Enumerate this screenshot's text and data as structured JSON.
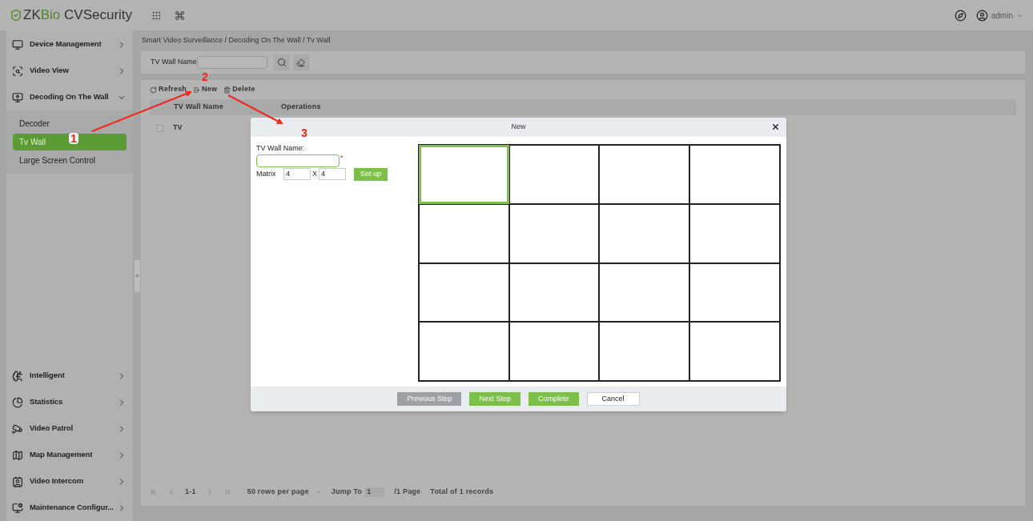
{
  "header": {
    "logo_part_1": "ZK",
    "logo_part_2": "Bio",
    "logo_part_3": "CVSecurity",
    "user": "admin"
  },
  "sidebar": {
    "top_items": [
      {
        "label": "Device Management",
        "expanded": false
      },
      {
        "label": "Video View",
        "expanded": false
      },
      {
        "label": "Decoding On The Wall",
        "expanded": true,
        "children": [
          {
            "label": "Decoder",
            "selected": false
          },
          {
            "label": "Tv Wall",
            "selected": true
          },
          {
            "label": "Large Screen Control",
            "selected": false
          }
        ]
      }
    ],
    "bottom_items": [
      {
        "label": "Intelligent",
        "expanded": false
      },
      {
        "label": "Statistics",
        "expanded": false
      },
      {
        "label": "Video Patrol",
        "expanded": false
      },
      {
        "label": "Map Management",
        "expanded": false
      },
      {
        "label": "Video Intercom",
        "expanded": false
      },
      {
        "label": "Maintenance Configur...",
        "expanded": false
      }
    ]
  },
  "breadcrumb": "Smart Video Surveillance / Decoding On The Wall / Tv Wall",
  "search": {
    "label": "TV Wall Name"
  },
  "toolbar": [
    "Refresh",
    "New",
    "Delete"
  ],
  "table": {
    "columns": [
      "TV Wall Name",
      "Operations"
    ],
    "rows": [
      {
        "name": "TV",
        "checked": false
      }
    ]
  },
  "pagination": {
    "range": "1-1",
    "page_size": "50 rows per page",
    "jump_label": "Jump To",
    "jump_value": "1",
    "pages": "/1 Page",
    "total": "Total of 1 records"
  },
  "dialog": {
    "title": "New",
    "name_label": "TV Wall Name:",
    "required_mark": "*",
    "matrix_label": "Matrix",
    "rows_value": "4",
    "separator": "X",
    "cols_value": "4",
    "setup_button": "Set up",
    "cells": [
      {
        "selected": true
      },
      {
        "selected": false
      },
      {
        "selected": false
      },
      {
        "selected": false
      },
      {
        "selected": false
      },
      {
        "selected": false
      },
      {
        "selected": false
      },
      {
        "selected": false
      },
      {
        "selected": false
      },
      {
        "selected": false
      },
      {
        "selected": false
      },
      {
        "selected": false
      },
      {
        "selected": false
      },
      {
        "selected": false
      },
      {
        "selected": false
      },
      {
        "selected": false
      }
    ],
    "buttons": [
      {
        "label": "Previous Step",
        "kind": "primary",
        "disabled": true
      },
      {
        "label": "Next Step",
        "kind": "primary",
        "disabled": false
      },
      {
        "label": "Complete",
        "kind": "primary",
        "disabled": false
      },
      {
        "label": "Cancel",
        "kind": "default",
        "disabled": false
      }
    ]
  },
  "annotations": [
    {
      "label": "1"
    },
    {
      "label": "2"
    },
    {
      "label": "3"
    }
  ]
}
